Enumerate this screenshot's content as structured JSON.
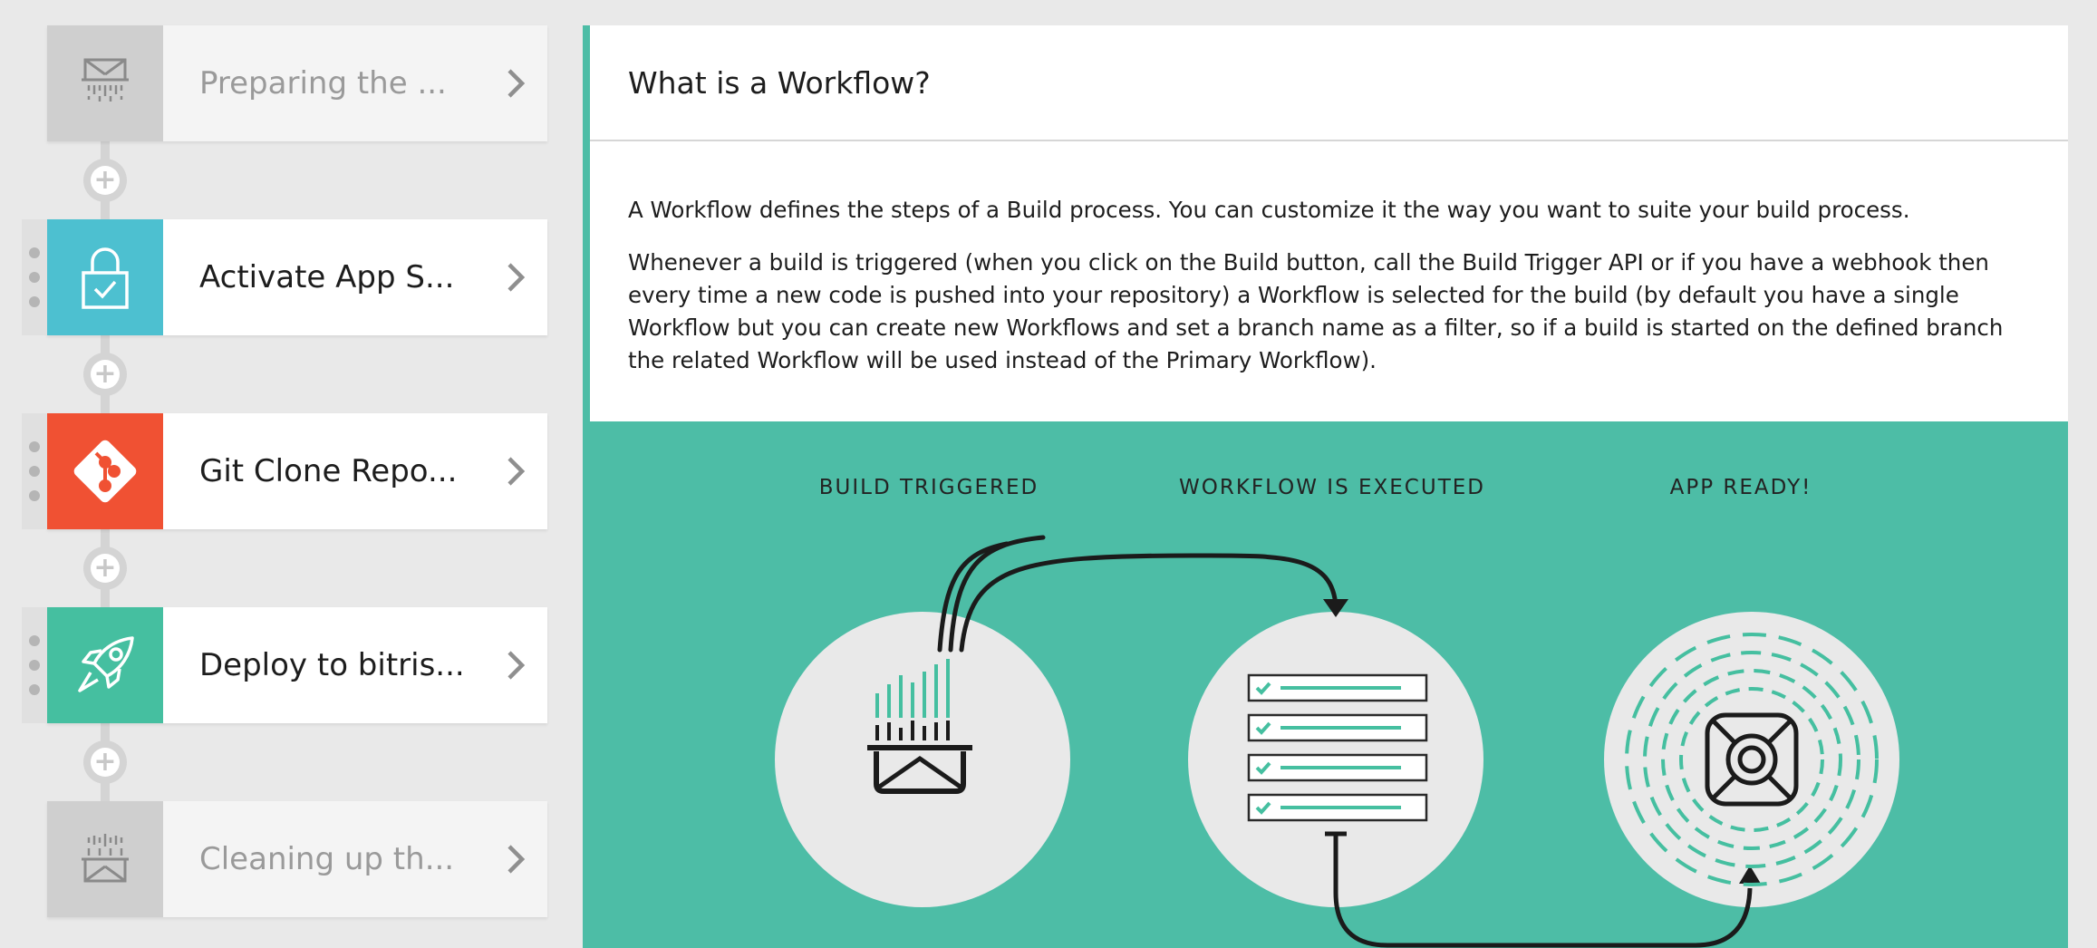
{
  "sidebar": {
    "steps": [
      {
        "label": "Preparing the ...",
        "icon": "builder-icon",
        "icon_bg": "#cfcfcf",
        "state": "muted"
      },
      {
        "label": "Activate App S...",
        "icon": "lock-check-icon",
        "icon_bg": "#4dc0d0",
        "state": "active"
      },
      {
        "label": "Git Clone Repo...",
        "icon": "git-icon",
        "icon_bg": "#f05133",
        "state": "active"
      },
      {
        "label": "Deploy to bitris...",
        "icon": "rocket-icon",
        "icon_bg": "#45bfa0",
        "state": "active"
      },
      {
        "label": "Cleaning up th...",
        "icon": "builder-icon",
        "icon_bg": "#cfcfcf",
        "state": "muted"
      }
    ],
    "add_step_label": "+"
  },
  "panel": {
    "title": "What is a Workflow?",
    "paragraph1": "A Workflow defines the steps of a Build process. You can customize it the way you want to suite your build process.",
    "paragraph2": "Whenever a build is triggered (when you click on the Build button, call the Build Trigger API or if you have a webhook then every time a new code is pushed into your repository) a Workflow is selected for the build (by default you have a single Workflow but you can create new Workflows and set a branch name as a filter, so if a build is started on the defined branch the related Workflow will be used instead of the Primary Workflow)."
  },
  "diagram": {
    "stages": [
      "BUILD TRIGGERED",
      "WORKFLOW IS EXECUTED",
      "APP READY!"
    ],
    "background": "#4dbda6",
    "accent": "#45bfa0"
  }
}
